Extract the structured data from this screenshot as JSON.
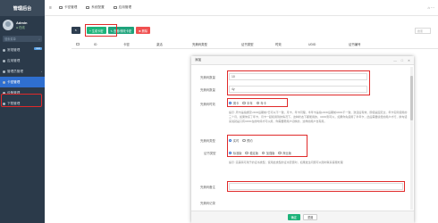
{
  "app": {
    "title": "管理后台"
  },
  "user": {
    "name": "Admin",
    "status": "● 在线"
  },
  "sidebar": {
    "search_placeholder": "搜索菜单",
    "items": [
      {
        "label": "常规管理",
        "badge": "new"
      },
      {
        "label": "应用管理"
      },
      {
        "label": "管理员管理"
      },
      {
        "label": "卡密管理"
      },
      {
        "label": "设备管理"
      },
      {
        "label": "下载管理"
      }
    ]
  },
  "topbar": {
    "tabs": [
      "卡密管理",
      "系统配置",
      "应用管理"
    ],
    "right": "⌂ ⋯"
  },
  "toolbar": {
    "btn_refresh": "↻",
    "btn_add": "+ 生成卡密",
    "btn_edit": "✎ 查看/修改卡密",
    "btn_delete": "✖ 删除",
    "search_placeholder": "搜索"
  },
  "table": {
    "headers": [
      "ID",
      "卡密",
      "激活",
      "完美码类型",
      "证书类型",
      "时效",
      "UDID",
      "证书编号"
    ]
  },
  "modal": {
    "title": "添加",
    "controls": {
      "min": "—",
      "max": "□",
      "close": "✕"
    },
    "fields": {
      "code_label": "完美码数量",
      "code_value": "10",
      "count_label": "完美码数量",
      "count_value": "4y",
      "validity_label": "完美码时效",
      "validity_options": [
        "周卡",
        "半年",
        "年卡"
      ],
      "hint1": "提示: 周卡是指绑定UDID后期前7日可以不一致，月卡，年卡同理，半年卡是指UDID后期前UDID不一致，激活后有效，即使是固定过，年卡实际使用的三个月，如果你买了年卡，月卡一起和用到的情况下，这种状态下都能用的，UDID则可以，如果你先使用了半年卡，此后需要续费的用户才行，换句话来说就是只有UDID在的时候才可以用，你需要帮用户切换的，这样的用户也有用。",
      "type_label": "完美码类型",
      "type_options": [
        "实时",
        "预约"
      ],
      "cert_label": "证书类型",
      "cert_options": [
        "标准版",
        "稳定版",
        "加强版",
        "商业版"
      ],
      "hint2": "提示: 完美码可用于的证书类型，使用此类型的证书安装时，如果发生问题可以随时联系客服处理",
      "remark_label": "完美码备注",
      "remark_value": "",
      "partial_label": "完美码记录"
    },
    "footer": {
      "ok": "确定",
      "reset": "重置"
    }
  }
}
